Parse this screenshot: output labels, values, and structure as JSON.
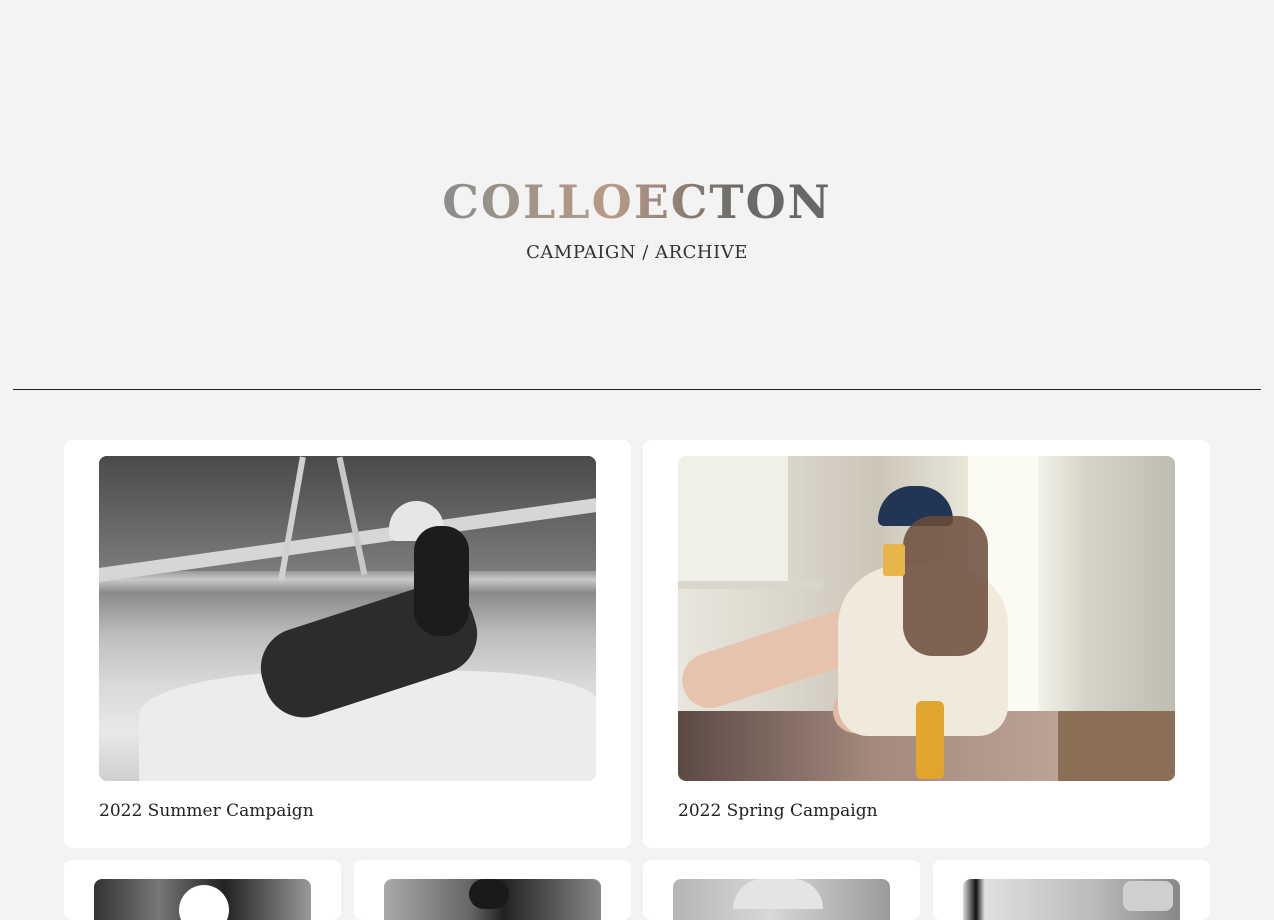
{
  "header": {
    "brand": "COLLOECTON",
    "subtitle": "CAMPAIGN / ARCHIVE"
  },
  "campaigns": [
    {
      "title": "2022 Summer Campaign",
      "photo": "black-and-white photo of a woman in a cap reading on a boat net"
    },
    {
      "title": "2022 Spring Campaign",
      "photo": "color photo of a woman in a navy cap drinking juice in a kitchen"
    }
  ],
  "more_cards_count": 4,
  "colors": {
    "background": "#f3f3f3",
    "card": "#ffffff",
    "text": "#222222"
  }
}
